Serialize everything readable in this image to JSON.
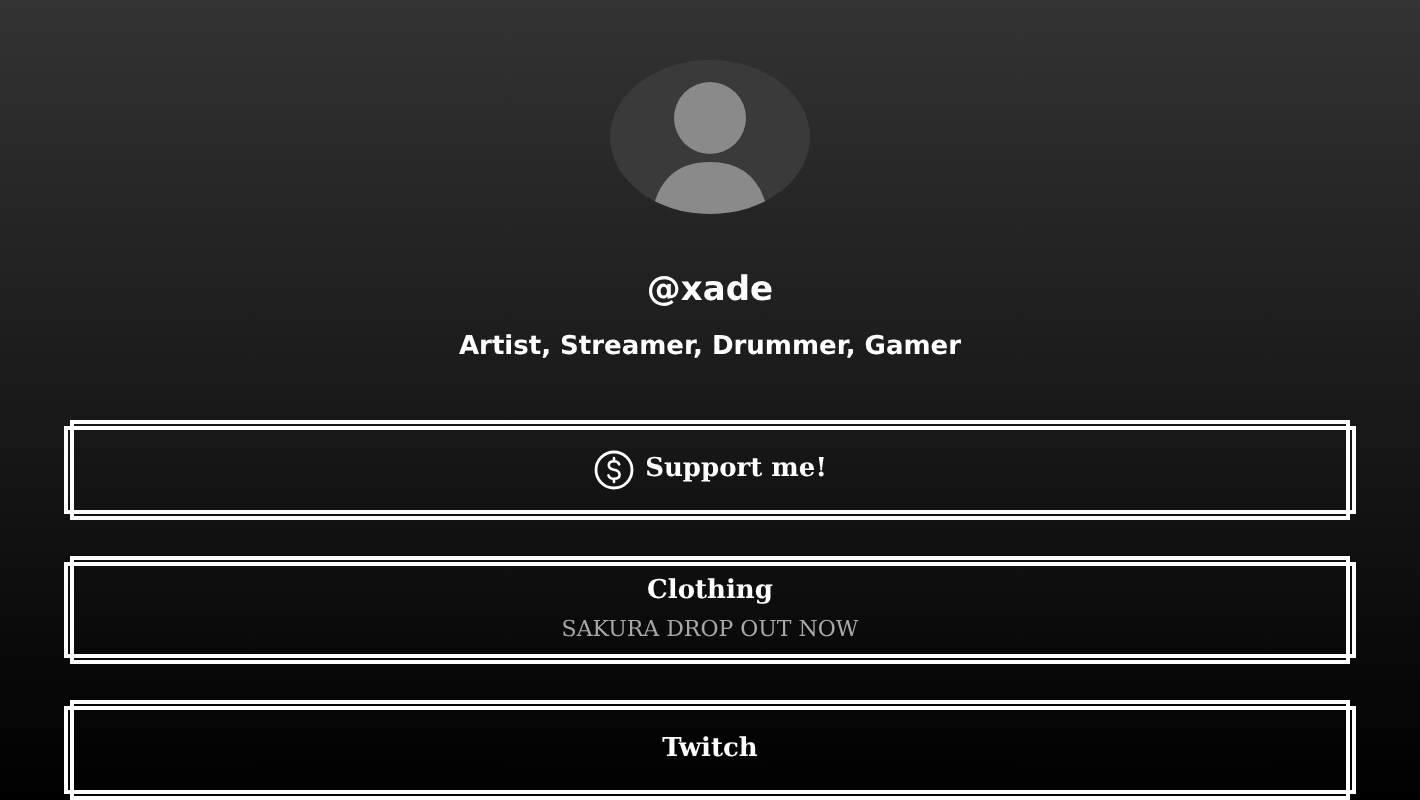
{
  "profile": {
    "handle": "@xade",
    "bio": "Artist, Streamer, Drummer, Gamer"
  },
  "links": [
    {
      "kind": "support",
      "title": "Support me!"
    },
    {
      "kind": "plain",
      "title": "Clothing",
      "subtitle": "SAKURA DROP OUT NOW"
    },
    {
      "kind": "plain",
      "title": "Twitch"
    }
  ]
}
